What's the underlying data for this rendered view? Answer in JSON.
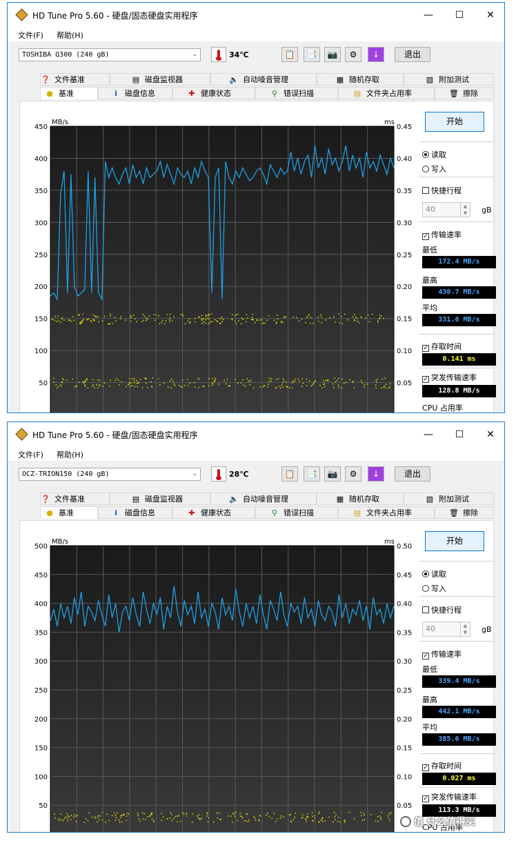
{
  "screens": [
    {
      "title": "HD Tune Pro 5.60 - 硬盘/固态硬盘实用程序",
      "menu": [
        "文件(F)",
        "帮助(H)"
      ],
      "drive": "TOSHIBA Q300 (240 gB)",
      "temperature": "34℃",
      "exit_label": "退出",
      "tabs_top": [
        "文件基准",
        "磁盘监视器",
        "自动噪音管理",
        "随机存取",
        "附加测试"
      ],
      "tabs_bottom": [
        "基准",
        "磁盘信息",
        "健康状态",
        "错误扫描",
        "文件夹占用率",
        "擦除"
      ],
      "start_label": "开始",
      "read_label": "读取",
      "write_label": "写入",
      "quick_label": "快捷行程",
      "quick_value": "40",
      "quick_unit": "gB",
      "transfer_label": "传输速率",
      "min_label": "最低",
      "min_value": "172.4 MB/s",
      "max_label": "最高",
      "max_value": "430.7 MB/s",
      "avg_label": "平均",
      "avg_value": "331.6 MB/s",
      "access_label": "存取时间",
      "access_value": "0.141 ms",
      "burst_label": "突发传输速率",
      "burst_value": "128.8 MB/s",
      "cpu_label": "CPU 占用率",
      "chart_data": {
        "type": "line",
        "y_left_unit": "MB/s",
        "y_right_unit": "ms",
        "y_left_ticks": [
          450,
          400,
          350,
          300,
          250,
          200,
          150,
          100,
          50
        ],
        "y_right_ticks": [
          "0.45",
          "0.40",
          "0.35",
          "0.30",
          "0.25",
          "0.20",
          "0.15",
          "0.10",
          "0.05"
        ],
        "ylim_left": [
          0,
          450
        ],
        "ylim_right": [
          0,
          0.45
        ],
        "line_color": "#1ea0e6",
        "dot_color": "#e6e600",
        "transfer_x": [
          0,
          1,
          2,
          3,
          4,
          5,
          6,
          7,
          8,
          9,
          10,
          11,
          12,
          13,
          14,
          15,
          16,
          17,
          18,
          19,
          20,
          21,
          22,
          23,
          24,
          25,
          26,
          27,
          28,
          29,
          30,
          31,
          32,
          33,
          34,
          35,
          36,
          37,
          38,
          39,
          40,
          41,
          42,
          43,
          44,
          45,
          46,
          47,
          48,
          49,
          50,
          51,
          52,
          53,
          54,
          55,
          56,
          57,
          58,
          59,
          60,
          61,
          62,
          63,
          64,
          65,
          66,
          67,
          68,
          69,
          70,
          71,
          72,
          73,
          74,
          75,
          76,
          77,
          78,
          79,
          80,
          81,
          82,
          83,
          84,
          85,
          86,
          87,
          88,
          89,
          90,
          91,
          92,
          93,
          94,
          95,
          96,
          97,
          98,
          99,
          100
        ],
        "transfer_mbps": [
          185,
          190,
          180,
          345,
          380,
          190,
          375,
          200,
          185,
          190,
          195,
          380,
          190,
          370,
          190,
          180,
          395,
          370,
          385,
          370,
          360,
          375,
          385,
          360,
          390,
          370,
          380,
          360,
          385,
          370,
          375,
          380,
          395,
          370,
          390,
          375,
          360,
          385,
          375,
          370,
          380,
          360,
          385,
          370,
          395,
          380,
          370,
          190,
          370,
          385,
          180,
          395,
          370,
          360,
          380,
          370,
          385,
          375,
          365,
          370,
          380,
          385,
          375,
          360,
          390,
          380,
          370,
          385,
          375,
          380,
          410,
          380,
          400,
          375,
          395,
          405,
          370,
          420,
          385,
          400,
          375,
          415,
          390,
          400,
          380,
          395,
          420,
          380,
          405,
          385,
          400,
          370,
          410,
          385,
          395,
          380,
          405,
          390,
          375,
          400,
          385
        ],
        "access_band_ms": [
          0.15,
          0.05
        ]
      }
    },
    {
      "title": "HD Tune Pro 5.60 - 硬盘/固态硬盘实用程序",
      "menu": [
        "文件(F)",
        "帮助(H)"
      ],
      "drive": "OCZ-TRION150 (240 gB)",
      "temperature": "28℃",
      "exit_label": "退出",
      "tabs_top": [
        "文件基准",
        "磁盘监视器",
        "自动噪音管理",
        "随机存取",
        "附加测试"
      ],
      "tabs_bottom": [
        "基准",
        "磁盘信息",
        "健康状态",
        "错误扫描",
        "文件夹占用率",
        "擦除"
      ],
      "start_label": "开始",
      "read_label": "读取",
      "write_label": "写入",
      "quick_label": "快捷行程",
      "quick_value": "40",
      "quick_unit": "gB",
      "transfer_label": "传输速率",
      "min_label": "最低",
      "min_value": "339.4 MB/s",
      "max_label": "最高",
      "max_value": "442.1 MB/s",
      "avg_label": "平均",
      "avg_value": "385.6 MB/s",
      "access_label": "存取时间",
      "access_value": "0.027 ms",
      "burst_label": "突发传输速率",
      "burst_value": "113.3 MB/s",
      "cpu_label": "CPU 占用率",
      "chart_data": {
        "type": "line",
        "y_left_unit": "MB/s",
        "y_right_unit": "ms",
        "y_left_ticks": [
          500,
          450,
          400,
          350,
          300,
          250,
          200,
          150,
          100,
          50
        ],
        "y_right_ticks": [
          "0.50",
          "0.45",
          "0.40",
          "0.35",
          "0.30",
          "0.25",
          "0.20",
          "0.15",
          "0.10",
          "0.05"
        ],
        "ylim_left": [
          0,
          500
        ],
        "ylim_right": [
          0,
          0.5
        ],
        "line_color": "#1ea0e6",
        "dot_color": "#e6e600",
        "transfer_x": [
          0,
          1,
          2,
          3,
          4,
          5,
          6,
          7,
          8,
          9,
          10,
          11,
          12,
          13,
          14,
          15,
          16,
          17,
          18,
          19,
          20,
          21,
          22,
          23,
          24,
          25,
          26,
          27,
          28,
          29,
          30,
          31,
          32,
          33,
          34,
          35,
          36,
          37,
          38,
          39,
          40,
          41,
          42,
          43,
          44,
          45,
          46,
          47,
          48,
          49,
          50,
          51,
          52,
          53,
          54,
          55,
          56,
          57,
          58,
          59,
          60,
          61,
          62,
          63,
          64,
          65,
          66,
          67,
          68,
          69,
          70,
          71,
          72,
          73,
          74,
          75,
          76,
          77,
          78,
          79,
          80,
          81,
          82,
          83,
          84,
          85,
          86,
          87,
          88,
          89,
          90,
          91,
          92,
          93,
          94,
          95,
          96,
          97,
          98,
          99,
          100
        ],
        "transfer_mbps": [
          370,
          390,
          360,
          400,
          375,
          395,
          365,
          410,
          380,
          420,
          360,
          395,
          385,
          370,
          405,
          380,
          360,
          415,
          375,
          400,
          350,
          385,
          395,
          370,
          410,
          380,
          360,
          420,
          390,
          365,
          400,
          380,
          410,
          355,
          395,
          375,
          430,
          385,
          360,
          405,
          380,
          395,
          365,
          420,
          375,
          390,
          360,
          400,
          385,
          355,
          410,
          380,
          395,
          370,
          425,
          385,
          360,
          400,
          375,
          395,
          365,
          415,
          380,
          355,
          405,
          390,
          370,
          420,
          380,
          360,
          400,
          385,
          395,
          365,
          410,
          375,
          390,
          360,
          405,
          380,
          370,
          395,
          385,
          360,
          415,
          375,
          400,
          365,
          390,
          380,
          405,
          370,
          395,
          355,
          410,
          380,
          390,
          365,
          400,
          375,
          395
        ],
        "access_band_ms": [
          0.03
        ]
      }
    }
  ],
  "watermark": "值 什么值得买"
}
